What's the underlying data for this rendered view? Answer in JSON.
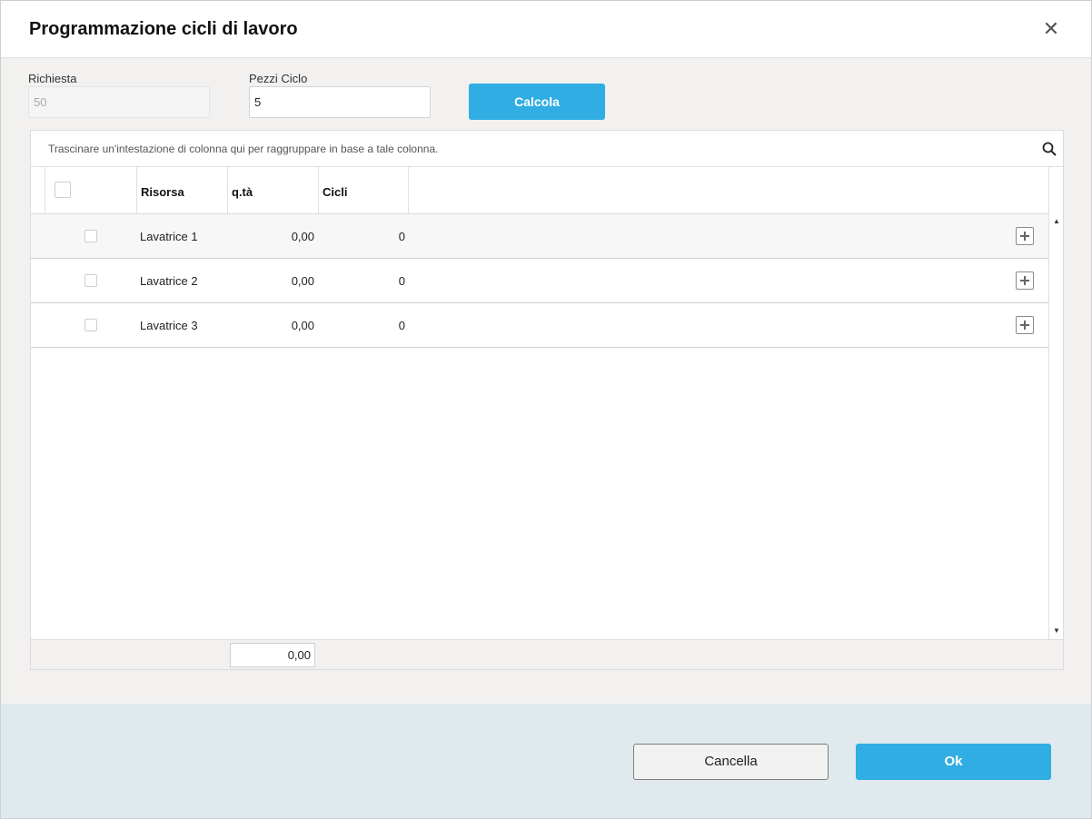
{
  "dialog": {
    "title": "Programmazione cicli di lavoro",
    "close_icon": "close-icon"
  },
  "form": {
    "richiesta": {
      "label": "Richiesta",
      "value": "50"
    },
    "pezzi_ciclo": {
      "label": "Pezzi Ciclo",
      "value": "5"
    },
    "calcola_label": "Calcola"
  },
  "grid": {
    "group_panel_text": "Trascinare un'intestazione di colonna qui per raggruppare in base a tale colonna.",
    "search_icon": "search-icon",
    "columns": [
      "Risorsa",
      "q.tà",
      "Cicli"
    ],
    "rows": [
      {
        "risorsa": "Lavatrice 1",
        "qta": "0,00",
        "cicli": "0"
      },
      {
        "risorsa": "Lavatrice 2",
        "qta": "0,00",
        "cicli": "0"
      },
      {
        "risorsa": "Lavatrice 3",
        "qta": "0,00",
        "cicli": "0"
      }
    ],
    "row_action_icon": "plus-square-icon",
    "footer_sum": "0,00"
  },
  "actions": {
    "cancel_label": "Cancella",
    "ok_label": "Ok"
  },
  "colors": {
    "accent": "#30ade3",
    "bottom_bar": "#dfe9ee",
    "dialog_bg": "#f2f1f0"
  }
}
